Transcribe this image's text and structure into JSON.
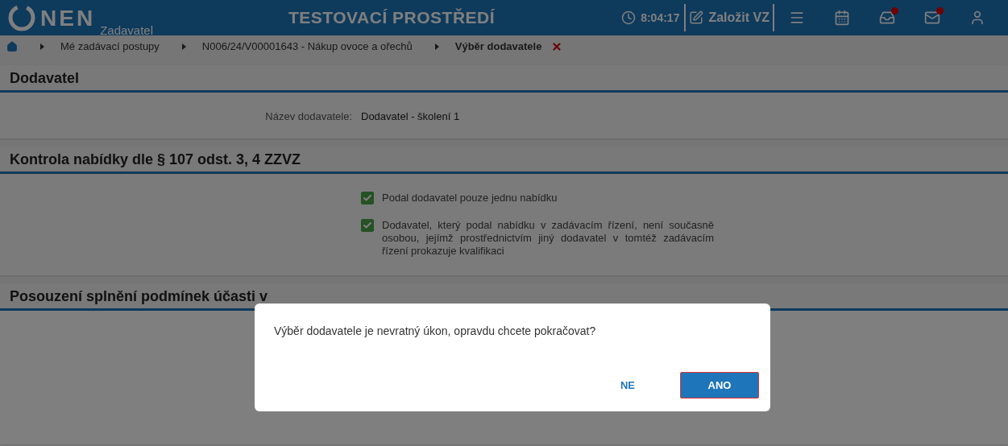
{
  "header": {
    "logo": "NEN",
    "role": "Zadavatel",
    "title": "TESTOVACÍ PROSTŘEDÍ",
    "time": "8:04:17",
    "create_button": "Založit VZ",
    "icons": [
      {
        "kind": "menu",
        "badge": false
      },
      {
        "kind": "calendar",
        "badge": false
      },
      {
        "kind": "inbox",
        "badge": true
      },
      {
        "kind": "mail",
        "badge": true
      },
      {
        "kind": "user",
        "badge": false
      }
    ]
  },
  "breadcrumb": [
    {
      "label": "Mé zadávací postupy",
      "current": false
    },
    {
      "label": "N006/24/V00001643 - Nákup ovoce a ořechů",
      "current": false
    },
    {
      "label": "Výběr dodavatele",
      "current": true
    }
  ],
  "sections": [
    {
      "title": "Dodavatel",
      "kind": "fields",
      "fields": [
        {
          "label": "Název dodavatele:",
          "value": "Dodavatel - školení 1"
        }
      ]
    },
    {
      "title": "Kontrola nabídky dle § 107 odst. 3, 4 ZZVZ",
      "kind": "checks",
      "items": [
        {
          "label": "Podal dodavatel pouze jednu nabídku",
          "checked": true
        },
        {
          "label": "Dodavatel, který podal nabídku v zadávacím řízení, není současně osobou, jejímž prostřednictvím jiný dodavatel v tomtéž zadávacím řízení prokazuje kvalifikaci",
          "checked": true
        }
      ]
    },
    {
      "title": "Posouzení splnění podmínek účasti v",
      "kind": "empty"
    }
  ],
  "dialog": {
    "message": "Výběr dodavatele je nevratný úkon, opravdu chcete pokračovat?",
    "buttons": [
      {
        "label": "NE",
        "primary": false,
        "focused": false
      },
      {
        "label": "ANO",
        "primary": true,
        "focused": true
      }
    ]
  }
}
